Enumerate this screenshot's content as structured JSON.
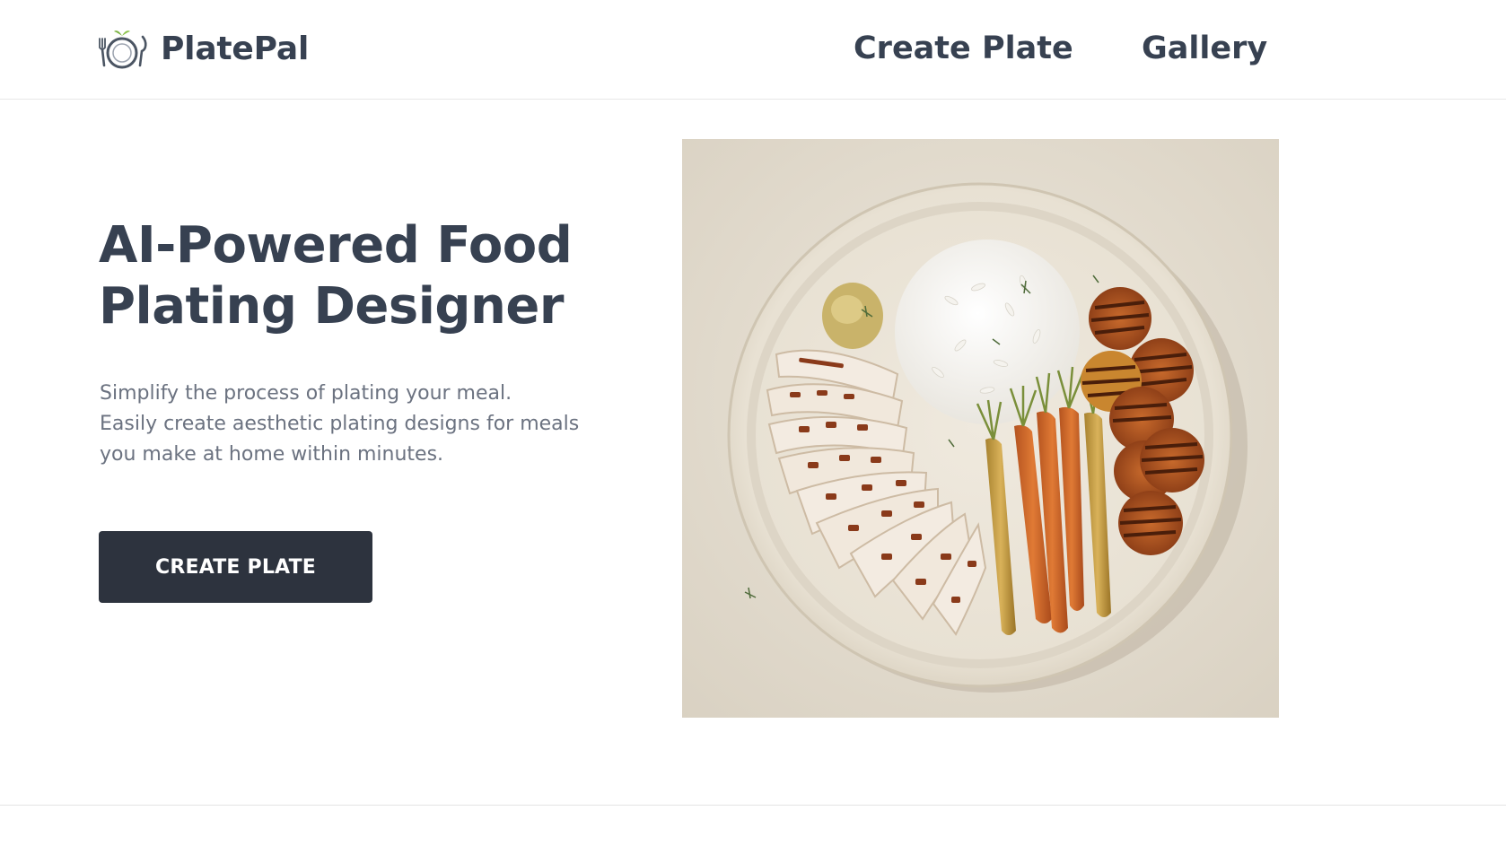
{
  "header": {
    "brand_name": "PlatePal",
    "logo_icon": "plate-with-cutlery-icon",
    "nav": [
      {
        "label": "Create Plate"
      },
      {
        "label": "Gallery"
      }
    ]
  },
  "hero": {
    "title_line1": "AI-Powered Food",
    "title_line2": "Plating Designer",
    "subtitle_lines": [
      "Simplify the process of plating your meal.",
      "Easily create aesthetic plating designs for meals",
      "you make at home within minutes."
    ],
    "cta_label": "CREATE PLATE",
    "image_subject": "plated-meal-photo"
  },
  "colors": {
    "text_dark": "#374151",
    "text_muted": "#6b7280",
    "button_bg": "#2d333e",
    "button_text": "#ffffff",
    "leaf_accent": "#7cb342"
  }
}
